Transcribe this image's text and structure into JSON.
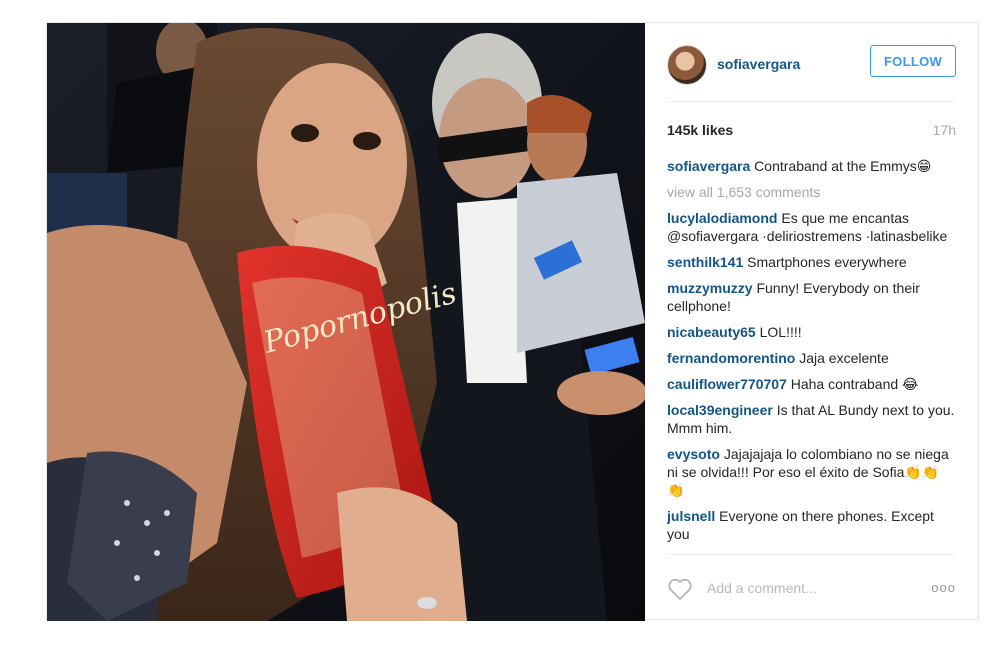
{
  "post": {
    "username": "sofiavergara",
    "follow_label": "FOLLOW",
    "likes": "145k likes",
    "time": "17h",
    "caption": {
      "user": "sofiavergara",
      "text": "Contraband at the Emmys😁"
    },
    "view_all": "view all 1,653 comments",
    "comments": [
      {
        "user": "lucylalodiamond",
        "text": "Es que me encantas @sofiavergara ·deliriostremens ·latinasbelike"
      },
      {
        "user": "senthilk141",
        "text": "Smartphones everywhere"
      },
      {
        "user": "muzzymuzzy",
        "text": "Funny! Everybody on their cellphone!"
      },
      {
        "user": "nicabeauty65",
        "text": "LOL!!!!"
      },
      {
        "user": "fernandomorentino",
        "text": "Jaja excelente"
      },
      {
        "user": "cauliflower770707",
        "text": "Haha contraband 😂"
      },
      {
        "user": "local39engineer",
        "text": "Is that AL Bundy next to you. Mmm him."
      },
      {
        "user": "evysoto",
        "text": "Jajajajaja lo colombiano no se niega ni se olvida!!! Por eso el éxito de Sofia👏👏👏"
      },
      {
        "user": "julsnell",
        "text": "Everyone on there phones. Except you"
      }
    ],
    "add_comment_placeholder": "Add a comment...",
    "more_label": "ooo",
    "icons": {
      "like": "heart-icon",
      "more": "more-options-icon"
    },
    "colors": {
      "link": "#125688",
      "follow": "#3897f0",
      "muted": "#a5a7aa"
    }
  }
}
